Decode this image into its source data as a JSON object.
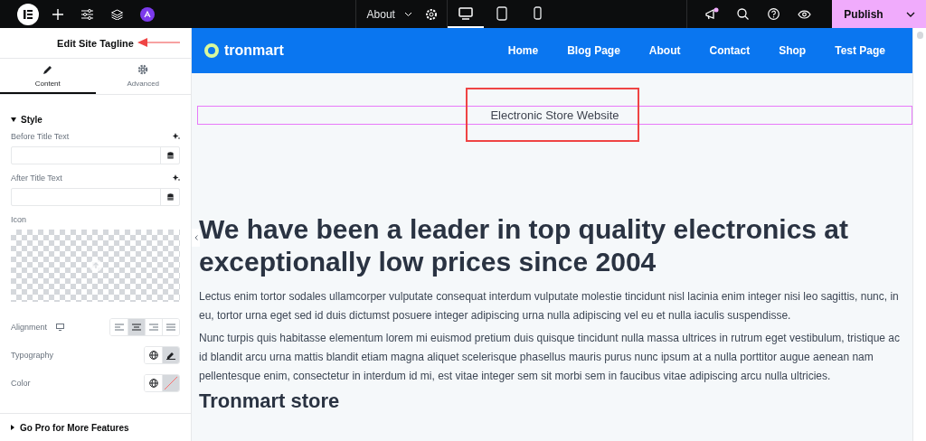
{
  "topbar": {
    "page_menu": "About",
    "devices": [
      {
        "kind": "desktop",
        "selected": true
      },
      {
        "kind": "tablet",
        "selected": false
      },
      {
        "kind": "mobile",
        "selected": false
      }
    ],
    "publish": "Publish"
  },
  "panel": {
    "title": "Edit Site Tagline",
    "tabs": [
      {
        "label": "Content",
        "kind": "pencil",
        "selected": true
      },
      {
        "label": "Advanced",
        "kind": "gear",
        "selected": false
      }
    ],
    "section": "Style",
    "fields": [
      {
        "label": "Before Title Text"
      },
      {
        "label": "After Title Text"
      }
    ],
    "icon_label": "Icon",
    "alignment": {
      "label": "Alignment",
      "options": [
        {
          "kind": "left",
          "selected": false
        },
        {
          "kind": "center",
          "selected": true
        },
        {
          "kind": "right",
          "selected": false
        },
        {
          "kind": "justify",
          "selected": false
        }
      ]
    },
    "typography": "Typography",
    "color_label": "Color",
    "footer": "Go Pro for More Features"
  },
  "preview": {
    "logo": "tronmart",
    "nav": [
      "Home",
      "Blog Page",
      "About",
      "Contact",
      "Shop",
      "Test Page"
    ],
    "tagline": "Electronic Store Website",
    "heading": "We have been a leader in top quality electronics at exceptionally low prices since 2004",
    "paragraphs": [
      "Lectus enim tortor sodales ullamcorper vulputate consequat interdum vulputate molestie tincidunt nisl lacinia enim integer nisi leo sagittis, nunc, in eu, tortor urna eget sed id duis dictumst posuere integer adipiscing urna nulla adipiscing vel eu et nulla iaculis suspendisse.",
      "Nunc turpis quis habitasse elementum lorem mi euismod pretium duis quisque tincidunt nulla massa ultrices in rutrum eget vestibulum, tristique ac id blandit arcu urna mattis blandit etiam magna aliquet scelerisque phasellus mauris purus nunc ipsum at a nulla porttitor augue aenean nam pellentesque enim, consectetur in interdum id mi, est vitae integer sem sit morbi sem in faucibus vitae adipiscing arcu nulla ultricies."
    ],
    "subheading": "Tronmart store"
  }
}
